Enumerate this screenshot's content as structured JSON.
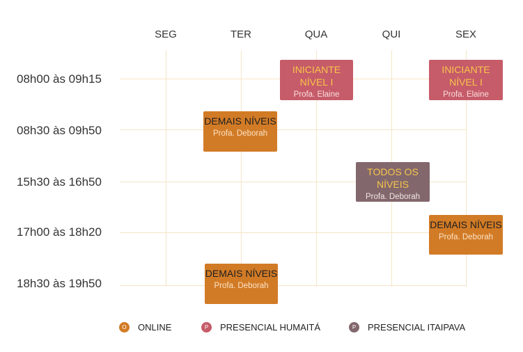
{
  "days": [
    "SEG",
    "TER",
    "QUA",
    "QUI",
    "SEX"
  ],
  "times": [
    "08h00 às 09h15",
    "08h30 às 09h50",
    "15h30 às 16h50",
    "17h00 às 18h20",
    "18h30 às 19h50"
  ],
  "blocks": [
    {
      "title": "INICIANTE NÍVEL I",
      "teacher": "Profa. Elaine",
      "type": "hum"
    },
    {
      "title": "INICIANTE NÍVEL I",
      "teacher": "Profa. Elaine",
      "type": "hum"
    },
    {
      "title": "DEMAIS NÍVEIS",
      "teacher": "Profa. Deborah",
      "type": "online"
    },
    {
      "title": "TODOS OS NÍVEIS",
      "teacher": "Profa. Deborah",
      "type": "ita"
    },
    {
      "title": "DEMAIS NÍVEIS",
      "teacher": "Profa. Deborah",
      "type": "online"
    },
    {
      "title": "DEMAIS NÍVEIS",
      "teacher": "Profa. Deborah",
      "type": "online"
    }
  ],
  "legend": [
    {
      "mark": "O",
      "label": "ONLINE",
      "color": "#d27b26"
    },
    {
      "mark": "P",
      "label": "PRESENCIAL HUMAITÁ",
      "color": "#c65b69"
    },
    {
      "mark": "P",
      "label": "PRESENCIAL ITAIPAVA",
      "color": "#82676c"
    }
  ]
}
